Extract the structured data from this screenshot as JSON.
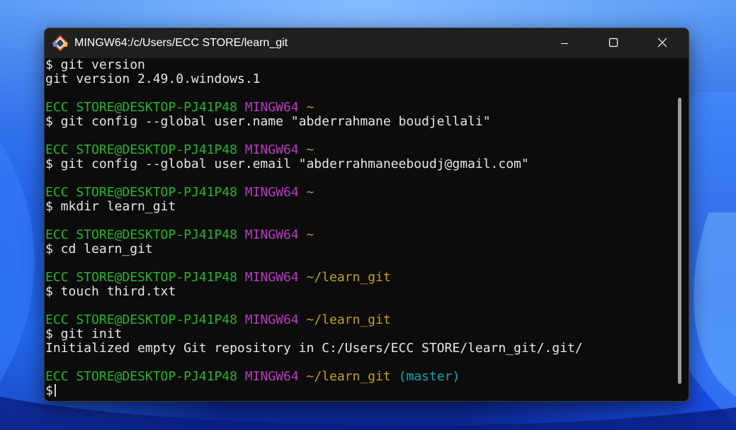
{
  "window": {
    "title": "MINGW64:/c/Users/ECC STORE/learn_git",
    "icon": "git-bash-icon",
    "controls": [
      "minimize-icon",
      "maximize-icon",
      "close-icon"
    ]
  },
  "colors": {
    "prompt_user": "#27b32f",
    "prompt_shell": "#b83cc0",
    "prompt_path": "#c1a01f",
    "prompt_branch": "#12a6b3",
    "text": "#e6e6e6",
    "background": "#0c0c0c"
  },
  "terminal": {
    "lines": [
      [
        {
          "text": "$ git version",
          "color": "white"
        }
      ],
      [
        {
          "text": "git version 2.49.0.windows.1",
          "color": "white"
        }
      ],
      [],
      [
        {
          "text": "ECC STORE@DESKTOP-PJ41P48",
          "color": "green"
        },
        {
          "text": " ",
          "color": "white"
        },
        {
          "text": "MINGW64",
          "color": "magenta"
        },
        {
          "text": " ",
          "color": "white"
        },
        {
          "text": "~",
          "color": "yellow"
        }
      ],
      [
        {
          "text": "$ git config --global user.name \"abderrahmane boudjellali\"",
          "color": "white"
        }
      ],
      [],
      [
        {
          "text": "ECC STORE@DESKTOP-PJ41P48",
          "color": "green"
        },
        {
          "text": " ",
          "color": "white"
        },
        {
          "text": "MINGW64",
          "color": "magenta"
        },
        {
          "text": " ",
          "color": "white"
        },
        {
          "text": "~",
          "color": "yellow"
        }
      ],
      [
        {
          "text": "$ git config --global user.email \"abderrahmaneeboudj@gmail.com\"",
          "color": "white"
        }
      ],
      [],
      [
        {
          "text": "ECC STORE@DESKTOP-PJ41P48",
          "color": "green"
        },
        {
          "text": " ",
          "color": "white"
        },
        {
          "text": "MINGW64",
          "color": "magenta"
        },
        {
          "text": " ",
          "color": "white"
        },
        {
          "text": "~",
          "color": "yellow"
        }
      ],
      [
        {
          "text": "$ mkdir learn_git",
          "color": "white"
        }
      ],
      [],
      [
        {
          "text": "ECC STORE@DESKTOP-PJ41P48",
          "color": "green"
        },
        {
          "text": " ",
          "color": "white"
        },
        {
          "text": "MINGW64",
          "color": "magenta"
        },
        {
          "text": " ",
          "color": "white"
        },
        {
          "text": "~",
          "color": "yellow"
        }
      ],
      [
        {
          "text": "$ cd learn_git",
          "color": "white"
        }
      ],
      [],
      [
        {
          "text": "ECC STORE@DESKTOP-PJ41P48",
          "color": "green"
        },
        {
          "text": " ",
          "color": "white"
        },
        {
          "text": "MINGW64",
          "color": "magenta"
        },
        {
          "text": " ",
          "color": "white"
        },
        {
          "text": "~/learn_git",
          "color": "yellow"
        }
      ],
      [
        {
          "text": "$ touch third.txt",
          "color": "white"
        }
      ],
      [],
      [
        {
          "text": "ECC STORE@DESKTOP-PJ41P48",
          "color": "green"
        },
        {
          "text": " ",
          "color": "white"
        },
        {
          "text": "MINGW64",
          "color": "magenta"
        },
        {
          "text": " ",
          "color": "white"
        },
        {
          "text": "~/learn_git",
          "color": "yellow"
        }
      ],
      [
        {
          "text": "$ git init",
          "color": "white"
        }
      ],
      [
        {
          "text": "Initialized empty Git repository in C:/Users/ECC STORE/learn_git/.git/",
          "color": "white"
        }
      ],
      [],
      [
        {
          "text": "ECC STORE@DESKTOP-PJ41P48",
          "color": "green"
        },
        {
          "text": " ",
          "color": "white"
        },
        {
          "text": "MINGW64",
          "color": "magenta"
        },
        {
          "text": " ",
          "color": "white"
        },
        {
          "text": "~/learn_git",
          "color": "yellow"
        },
        {
          "text": " ",
          "color": "white"
        },
        {
          "text": "(master)",
          "color": "cyan"
        }
      ]
    ],
    "current_prompt": "$"
  }
}
